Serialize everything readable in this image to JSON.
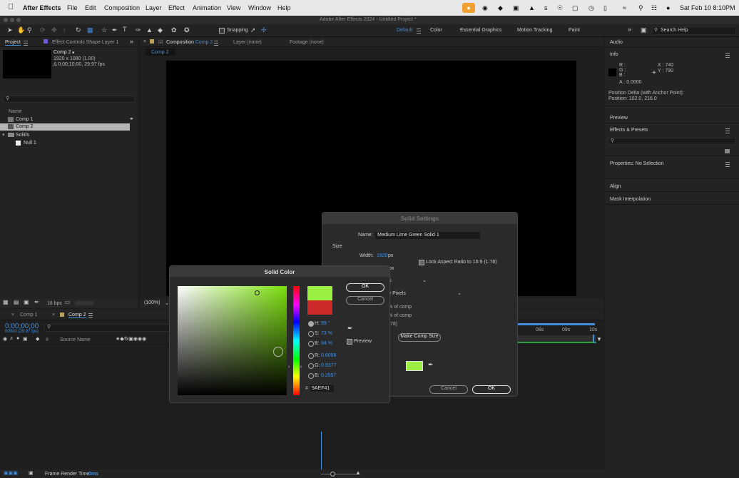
{
  "menubar": {
    "app_name": "After Effects",
    "items": [
      "File",
      "Edit",
      "Composition",
      "Layer",
      "Effect",
      "Animation",
      "View",
      "Window",
      "Help"
    ],
    "clock": "Sat Feb 10  8:10PM"
  },
  "window": {
    "title": "Adobe After Effects 2024 - Untitled Project *"
  },
  "toolbar": {
    "snapping_label": "Snapping",
    "workspaces": [
      "Default",
      "Color",
      "Essential Graphics",
      "Motion Tracking",
      "Paint"
    ],
    "search_placeholder": "Search Help"
  },
  "project_panel": {
    "tab_label": "Project",
    "effect_controls_tab": "Effect Controls Shape Layer 1",
    "comp_name": "Comp 2",
    "comp_dims": "1920 x 1080 (1.00)",
    "comp_duration": "Δ 0;00;10;00, 29.97 fps",
    "name_header": "Name",
    "items": [
      {
        "label": "Comp 1",
        "icon": "composition-icon"
      },
      {
        "label": "Comp 2",
        "icon": "composition-icon",
        "selected": true
      },
      {
        "label": "Solids",
        "icon": "folder-icon"
      },
      {
        "label": "Null 1",
        "icon": "solid-swatch-icon"
      }
    ],
    "bpc": "16 bpc"
  },
  "composition_panel": {
    "tab_prefix": "Composition",
    "tab_comp": "Comp 2",
    "layer_tab": "Layer (none)",
    "footage_tab": "Footage (none)",
    "breadcrumb": "Comp 2",
    "zoom": "(100%)"
  },
  "right_panels": {
    "audio": "Audio",
    "info": "Info",
    "r": "R :",
    "g": "G :",
    "b": "B :",
    "a": "A :  0.0000",
    "x": "X : 740",
    "y": "Y : 790",
    "position_delta": "Position Delta (with Anchor Point):",
    "position": "Position: 102.0, 216.0",
    "preview": "Preview",
    "effects_presets": "Effects & Presets",
    "properties": "Properties: No Selection",
    "align": "Align",
    "mask_interpolation": "Mask Interpolation"
  },
  "timeline": {
    "tab1": "Comp 1",
    "tab2": "Comp 2",
    "timecode": "0;00;00;00",
    "frame_info": "00000 (29.97 fps)",
    "source_name_header": "Source Name",
    "ruler_marks": [
      "08s",
      "09s",
      "10s"
    ],
    "frame_render_label": "Frame Render Time",
    "frame_render_value": "0ms"
  },
  "solid_settings": {
    "title": "Solid Settings",
    "name_label": "Name:",
    "name_value": "Medium Lime Green Solid 1",
    "size_label": "Size",
    "width_label": "Width:",
    "width_value": "1920",
    "width_unit": "px",
    "height_unit_partial": "px",
    "lock_label": "Lock Aspect Ratio to 16:9 (1.78)",
    "units_partial": "s",
    "pixel_aspect_partial": "re Pixels",
    "comp_pct1": "% of comp",
    "comp_pct2": "% of comp",
    "ratio_partial": ".78)",
    "make_comp_size": "Make Comp Size",
    "cancel": "Cancel",
    "ok": "OK",
    "swatch_color": "#9AEF41"
  },
  "solid_color": {
    "title": "Solid Color",
    "ok": "OK",
    "cancel": "Cancel",
    "preview_label": "Preview",
    "h_label": "H:",
    "h_value": "89 °",
    "s_label": "S:",
    "s_value": "73 %",
    "b_label": "B:",
    "b_value": "94 %",
    "r_label": "R:",
    "r_value": "0.6056",
    "g_label": "G:",
    "g_value": "0.9377",
    "b2_label": "B:",
    "b2_value": "0.2557",
    "hex_label": "#",
    "hex_value": "9AEF41",
    "new_color": "#9AEF41",
    "old_color": "#CC2A2A"
  }
}
